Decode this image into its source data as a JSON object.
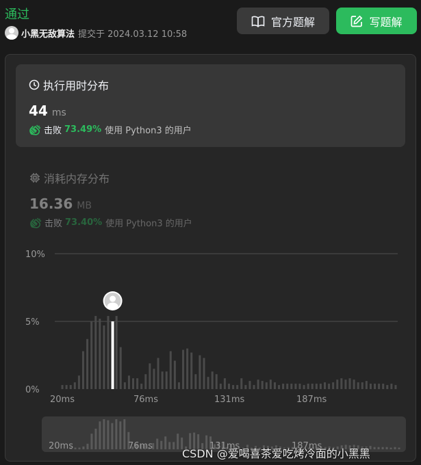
{
  "header": {
    "status": "通过",
    "username": "小黑无敌算法",
    "submitted_at": "提交于 2024.03.12 10:58",
    "solution_button": "官方题解",
    "write_button": "写题解"
  },
  "runtime": {
    "title": "执行用时分布",
    "value": "44",
    "unit": "ms",
    "beat_label": "击败",
    "beat_pct": "73.49%",
    "beat_text": "使用 Python3 的用户"
  },
  "memory": {
    "title": "消耗内存分布",
    "value": "16.36",
    "unit": "MB",
    "beat_label": "击败",
    "beat_pct": "73.40%",
    "beat_text": "使用 Python3 的用户"
  },
  "chart_data": {
    "type": "bar",
    "ylim": [
      0,
      10
    ],
    "y_ticks": [
      "10%",
      "5%",
      "0%"
    ],
    "x_tick_labels": [
      "20ms",
      "76ms",
      "131ms",
      "187ms"
    ],
    "highlight_index": 12,
    "values": [
      0.3,
      0.3,
      0.3,
      0.5,
      1.0,
      2.8,
      3.7,
      5.0,
      5.4,
      5.2,
      4.7,
      5.4,
      5.0,
      5.4,
      3.1,
      0.5,
      1.0,
      0.8,
      0.8,
      0.4,
      1.1,
      1.9,
      1.5,
      2.3,
      1.3,
      1.3,
      2.8,
      2.1,
      0.5,
      2.9,
      3.0,
      2.7,
      1.1,
      2.5,
      2.3,
      0.9,
      1.3,
      1.1,
      0.4,
      0.8,
      0.4,
      0.3,
      0.3,
      0.8,
      0.3,
      0.6,
      0.3,
      0.7,
      0.6,
      0.5,
      0.7,
      0.5,
      0.3,
      0.4,
      0.4,
      0.4,
      0.4,
      0.4,
      0.3,
      0.4,
      0.4,
      0.4,
      0.4,
      0.5,
      0.4,
      0.5,
      0.7,
      0.8,
      0.7,
      0.8,
      0.7,
      0.5,
      0.5,
      0.6,
      0.4,
      0.4,
      0.4,
      0.4,
      0.3,
      0.4,
      0.3
    ],
    "minimap_x_labels": [
      "20ms",
      "76ms",
      "131ms",
      "187ms"
    ]
  },
  "watermark": "CSDN @爱喝喜茶爱吃烤冷面的小黑黑",
  "colors": {
    "accent_green": "#2cbb5d",
    "bar": "#4a4a4a",
    "highlight_bar": "#ffffff"
  }
}
